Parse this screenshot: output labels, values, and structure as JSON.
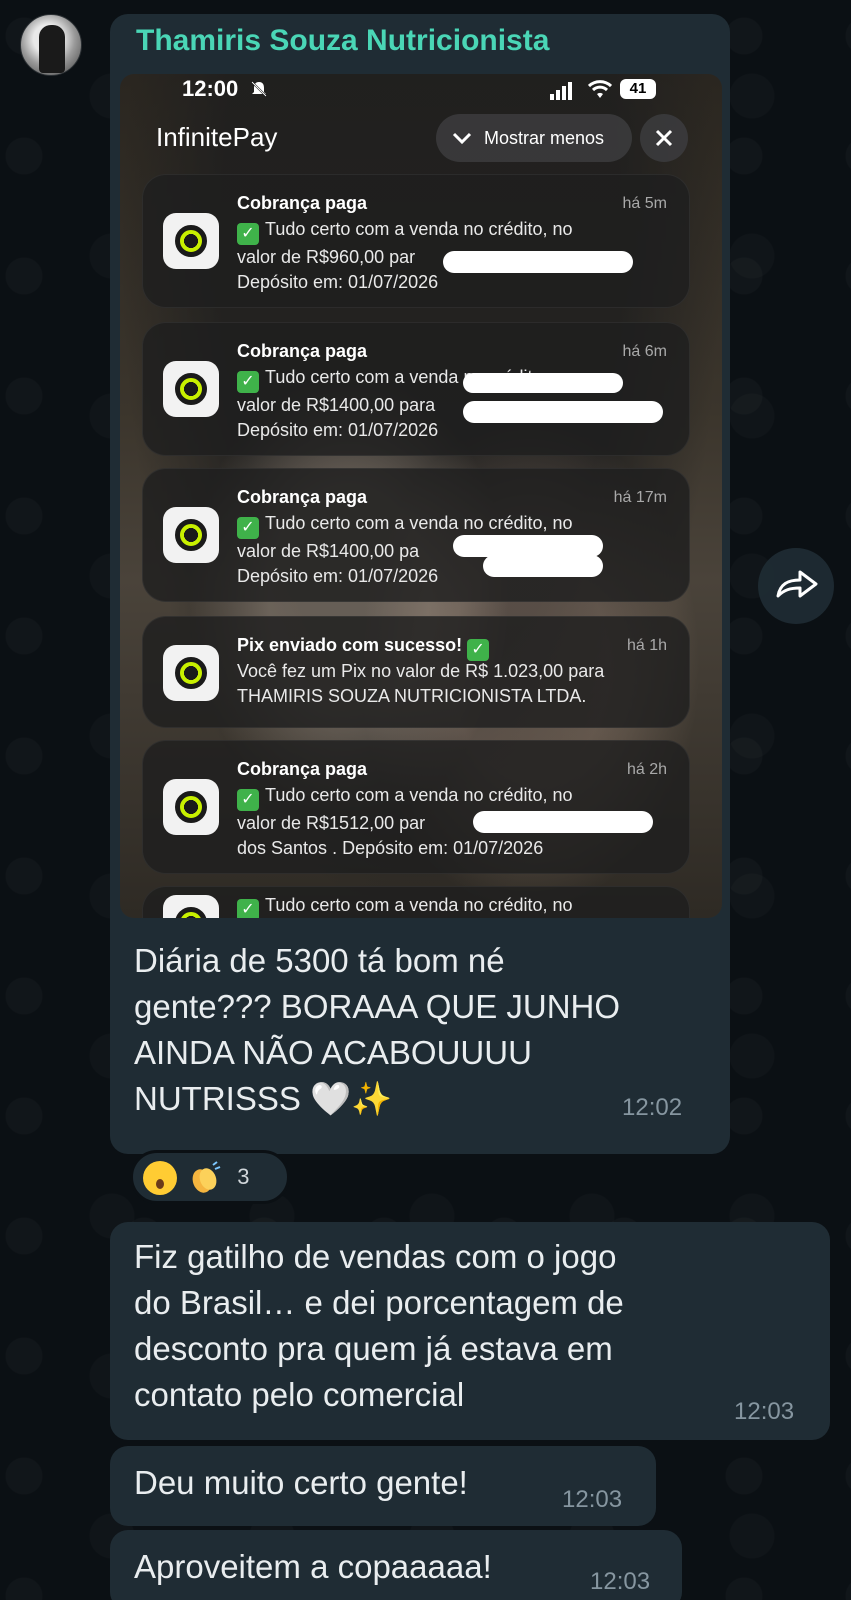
{
  "chat": {
    "sender_name": "Thamiris Souza Nutricionista",
    "avatar_icon": "avatar-photo"
  },
  "screenshot": {
    "status_time": "12:00",
    "battery": "41",
    "app_name": "InfinitePay",
    "show_less_label": "Mostrar menos",
    "notifications": [
      {
        "title": "Cobrança paga",
        "time": "há 5m",
        "line1": "Tudo certo com a venda no crédito, no",
        "line2": "valor de R$960,00 par",
        "line3": "Depósito em: 01/07/2026"
      },
      {
        "title": "Cobrança paga",
        "time": "há 6m",
        "line1": "Tudo certo com a venda no crédito, no",
        "line2": "valor de R$1400,00 para",
        "line3": "Depósito em: 01/07/2026"
      },
      {
        "title": "Cobrança paga",
        "time": "há 17m",
        "line1": "Tudo certo com a venda no crédito, no",
        "line2": "valor de R$1400,00 pa",
        "line3": "Depósito em: 01/07/2026"
      },
      {
        "title": "Pix enviado com sucesso!",
        "time": "há 1h",
        "line1": "Você fez um Pix no valor de R$ 1.023,00 para",
        "line2": "THAMIRIS SOUZA NUTRICIONISTA LTDA."
      },
      {
        "title": "Cobrança paga",
        "time": "há 2h",
        "line1": "Tudo certo com a venda no crédito, no",
        "line2": "valor de R$1512,00 par",
        "line3": "dos Santos . Depósito em: 01/07/2026"
      },
      {
        "line1": "Tudo certo com a venda no crédito, no"
      }
    ]
  },
  "messages": [
    {
      "text": "Diária de 5300 tá bom né gente??? BORAAA QUE JUNHO AINDA NÃO ACABOUUUU NUTRISSS 🤍✨",
      "lines": [
        "Diária de 5300 tá bom né",
        "gente??? BORAAA QUE JUNHO",
        "AINDA NÃO ACABOUUUU",
        "NUTRISSS 🤍✨"
      ],
      "time": "12:02"
    },
    {
      "lines": [
        "Fiz gatilho de vendas com o jogo",
        "do Brasil… e dei porcentagem de",
        "desconto pra quem já estava em",
        "contato pelo comercial"
      ],
      "time": "12:03"
    },
    {
      "lines": [
        "Deu muito certo gente!"
      ],
      "time": "12:03"
    },
    {
      "lines": [
        "Aproveitem a copaaaaa!"
      ],
      "time": "12:03"
    }
  ],
  "reactions": {
    "emojis": [
      "astonished-face",
      "clapping-hands"
    ],
    "count": "3"
  },
  "colors": {
    "background": "#0b1014",
    "bubble": "#1f2c34",
    "sender": "#4ad6b6",
    "timestamp": "#8696a0"
  }
}
